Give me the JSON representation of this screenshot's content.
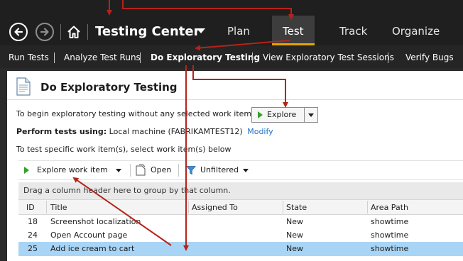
{
  "hub": {
    "title": "Testing Center",
    "tabs": [
      {
        "label": "Plan",
        "active": false
      },
      {
        "label": "Test",
        "active": true
      },
      {
        "label": "Track",
        "active": false
      },
      {
        "label": "Organize",
        "active": false
      }
    ]
  },
  "subnav": {
    "items": [
      {
        "label": "Run Tests",
        "active": false
      },
      {
        "label": "Analyze Test Runs",
        "active": false
      },
      {
        "label": "Do Exploratory Testing",
        "active": true
      },
      {
        "label": "View Exploratory Test Sessions",
        "active": false
      },
      {
        "label": "Verify Bugs",
        "active": false
      }
    ]
  },
  "page": {
    "title": "Do Exploratory Testing",
    "intro_text": "To begin exploratory testing without any selected work items:",
    "explore_label": "Explore",
    "perform_label": "Perform tests using:",
    "perform_value": "Local machine (FABRIKAMTEST12)",
    "modify_link": "Modify",
    "specific_text": "To test specific work item(s), select work item(s) below"
  },
  "toolbar": {
    "explore_work_item": "Explore work item",
    "open": "Open",
    "filter": "Unfiltered"
  },
  "grid": {
    "group_hint": "Drag a column header here to group by that column.",
    "columns": [
      "ID",
      "Title",
      "Assigned To",
      "State",
      "Area Path"
    ],
    "rows": [
      {
        "id": "18",
        "title": "Screenshot localization",
        "assigned_to": "",
        "state": "New",
        "area_path": "showtime",
        "selected": false
      },
      {
        "id": "24",
        "title": "Open Account page",
        "assigned_to": "",
        "state": "New",
        "area_path": "showtime",
        "selected": false
      },
      {
        "id": "25",
        "title": "Add ice cream to cart",
        "assigned_to": "",
        "state": "New",
        "area_path": "showtime",
        "selected": true
      }
    ]
  },
  "colors": {
    "top_bar": "#1f1f1f",
    "active_tab_underline": "#e8a300",
    "selected_row": "#a8d4f5",
    "link": "#1e70c4",
    "annotation_arrow": "#b5231a"
  },
  "icons": [
    "back-icon",
    "forward-icon",
    "home-icon",
    "document-icon",
    "play-icon",
    "caret-down-icon",
    "open-document-icon",
    "filter-icon"
  ]
}
